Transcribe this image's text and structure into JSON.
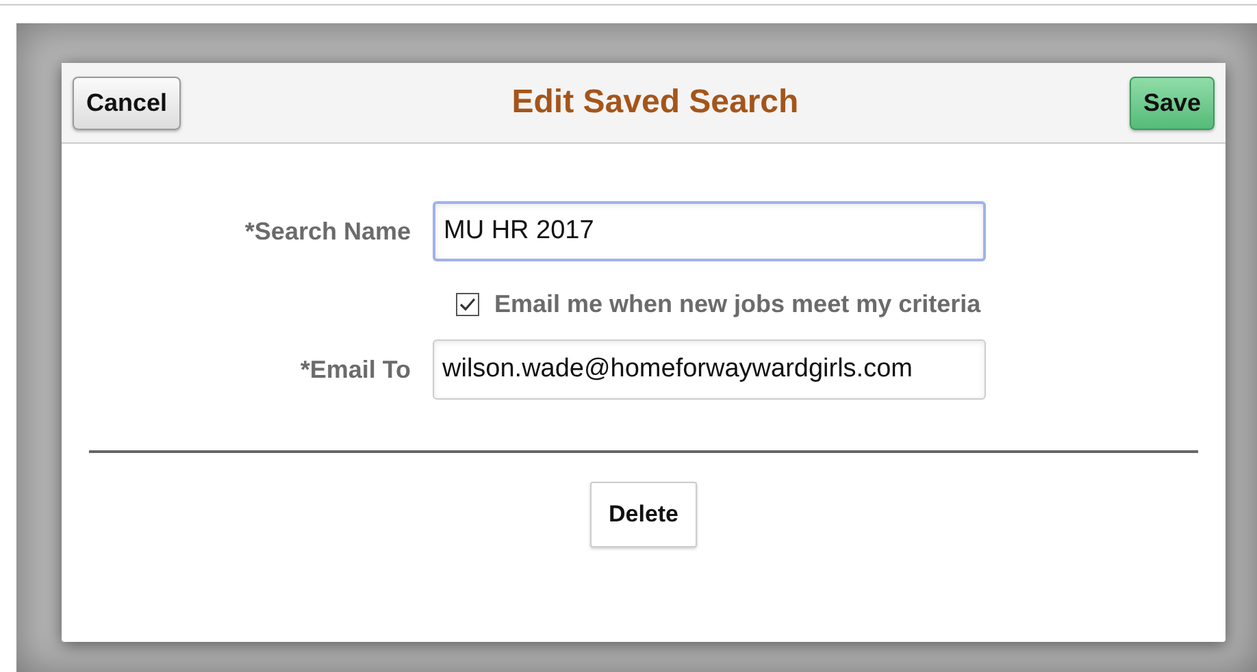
{
  "dialog": {
    "title": "Edit Saved Search",
    "cancel_button": "Cancel",
    "save_button": "Save",
    "fields": [
      {
        "label": "*Search Name",
        "value": "MU HR 2017",
        "focused": true
      },
      {
        "label": "*Email To",
        "value": "wilson.wade@homeforwaywardgirls.com",
        "focused": false
      }
    ],
    "email_option": {
      "label": "Email me when new jobs meet my criteria",
      "checked": true
    },
    "delete_button": "Delete"
  }
}
